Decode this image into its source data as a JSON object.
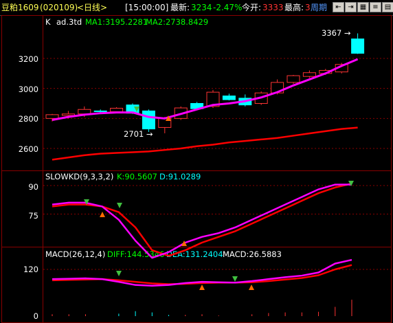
{
  "header": {
    "symbol": "豆粕1609",
    "code": "(020109)",
    "period": "<日线>",
    "time": "[15:00:00]",
    "latest_label": "最新:",
    "latest_value": "3234",
    "change": "-2.47%",
    "open_label": "今开:",
    "open_value": "3333",
    "high_label": "最高:",
    "high_value": "3",
    "cycle_tab": "周期",
    "buttons": [
      "⇤",
      "⇥",
      "▦",
      "≡",
      "▤"
    ]
  },
  "colors": {
    "up": "#ff3333",
    "down": "#00ffff",
    "ma1": "#ffffff",
    "ma2": "#ff0000",
    "k": "#ff00ff",
    "d": "#ff0000",
    "diff": "#ff00ff",
    "dea": "#ff0000",
    "macd_down_arrow": "#40c040",
    "grid": "#8a0000",
    "axis_text": "#ffffff"
  },
  "main_panel": {
    "label_k": "K",
    "label_ad": "ad.3td",
    "label_ma1": "MA1:3195.2281",
    "label_ma2": "MA2:2738.8429",
    "ticks": [
      "3200",
      "3000",
      "2800",
      "2600"
    ],
    "high_marker": "3367",
    "low_marker": "2701"
  },
  "kd_panel": {
    "title": "SLOWKD(9,3,3,2)",
    "k_label": "K:90.5607",
    "d_label": "D:91.0289",
    "ticks": [
      "90",
      "75"
    ]
  },
  "macd_panel": {
    "title": "MACD(26,12,4)",
    "diff_label": "DIFF:144.5346",
    "dea_label": "DEA:131.2404",
    "macd_label": "MACD:26.5883",
    "ticks": [
      "120",
      "0"
    ]
  },
  "chart_data": {
    "type": "candlestick",
    "candles": [
      {
        "o": 2800,
        "h": 2830,
        "l": 2780,
        "c": 2825
      },
      {
        "o": 2820,
        "h": 2850,
        "l": 2800,
        "c": 2830
      },
      {
        "o": 2830,
        "h": 2880,
        "l": 2810,
        "c": 2860
      },
      {
        "o": 2850,
        "h": 2860,
        "l": 2835,
        "c": 2848
      },
      {
        "o": 2845,
        "h": 2875,
        "l": 2835,
        "c": 2868
      },
      {
        "o": 2890,
        "h": 2900,
        "l": 2830,
        "c": 2835
      },
      {
        "o": 2850,
        "h": 2860,
        "l": 2710,
        "c": 2730
      },
      {
        "o": 2740,
        "h": 2810,
        "l": 2701,
        "c": 2800
      },
      {
        "o": 2800,
        "h": 2880,
        "l": 2790,
        "c": 2870
      },
      {
        "o": 2900,
        "h": 2910,
        "l": 2855,
        "c": 2865
      },
      {
        "o": 2880,
        "h": 2990,
        "l": 2870,
        "c": 2975
      },
      {
        "o": 2950,
        "h": 2965,
        "l": 2920,
        "c": 2925
      },
      {
        "o": 2935,
        "h": 2960,
        "l": 2880,
        "c": 2890
      },
      {
        "o": 2900,
        "h": 2980,
        "l": 2890,
        "c": 2970
      },
      {
        "o": 2970,
        "h": 3060,
        "l": 2960,
        "c": 3040
      },
      {
        "o": 3040,
        "h": 3090,
        "l": 3030,
        "c": 3085
      },
      {
        "o": 3080,
        "h": 3120,
        "l": 3070,
        "c": 3105
      },
      {
        "o": 3100,
        "h": 3130,
        "l": 3090,
        "c": 3120
      },
      {
        "o": 3110,
        "h": 3170,
        "l": 3100,
        "c": 3160
      },
      {
        "o": 3330,
        "h": 3367,
        "l": 3230,
        "c": 3234
      }
    ],
    "ma1": [
      2790,
      2810,
      2825,
      2835,
      2840,
      2840,
      2810,
      2800,
      2830,
      2860,
      2890,
      2900,
      2915,
      2940,
      2975,
      3020,
      3060,
      3100,
      3150,
      3195
    ],
    "ma2": [
      2525,
      2540,
      2555,
      2565,
      2570,
      2575,
      2580,
      2590,
      2600,
      2615,
      2625,
      2640,
      2650,
      2660,
      2670,
      2685,
      2700,
      2715,
      2730,
      2739
    ],
    "kd_k": [
      80,
      81,
      81,
      79,
      72,
      61,
      52,
      55,
      60,
      63,
      65,
      68,
      72,
      76,
      80,
      84,
      88,
      90.5,
      90.56
    ],
    "kd_d": [
      79,
      80,
      80,
      79,
      76,
      68,
      56,
      53,
      56,
      60,
      63,
      66,
      70,
      74,
      78,
      82,
      86,
      89,
      91.03
    ],
    "diff": [
      95,
      96,
      97,
      95,
      88,
      80,
      78,
      80,
      85,
      88,
      87,
      86,
      90,
      95,
      100,
      104,
      112,
      135,
      144.53
    ],
    "dea": [
      92,
      93,
      94,
      95,
      92,
      88,
      84,
      82,
      83,
      85,
      86,
      86,
      87,
      90,
      94,
      98,
      105,
      120,
      131.24
    ],
    "macd": [
      3,
      3,
      3,
      0,
      -4,
      -8,
      -6,
      -2,
      2,
      3,
      1,
      0,
      3,
      5,
      6,
      6,
      7,
      15,
      26.59
    ],
    "ylim_main": [
      2500,
      3400
    ],
    "ylim_kd": [
      60,
      95
    ],
    "ylim_macd": [
      0,
      150
    ]
  }
}
